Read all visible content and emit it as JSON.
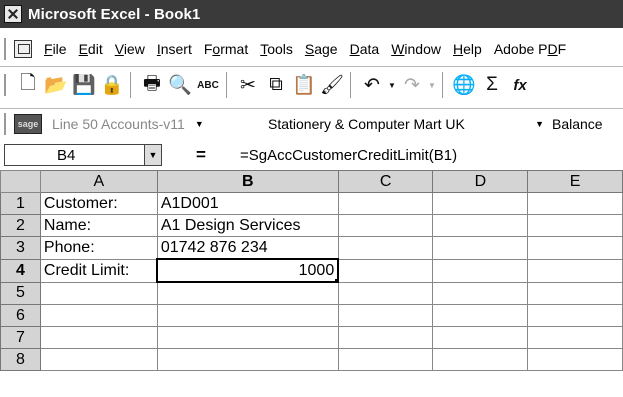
{
  "window": {
    "title": "Microsoft Excel - Book1"
  },
  "menu": [
    {
      "name": "file",
      "pre": "",
      "ul": "F",
      "post": "ile"
    },
    {
      "name": "edit",
      "pre": "",
      "ul": "E",
      "post": "dit"
    },
    {
      "name": "view",
      "pre": "",
      "ul": "V",
      "post": "iew"
    },
    {
      "name": "insert",
      "pre": "",
      "ul": "I",
      "post": "nsert"
    },
    {
      "name": "format",
      "pre": "F",
      "ul": "o",
      "post": "rmat"
    },
    {
      "name": "tools",
      "pre": "",
      "ul": "T",
      "post": "ools"
    },
    {
      "name": "sage",
      "pre": "",
      "ul": "S",
      "post": "age"
    },
    {
      "name": "data",
      "pre": "",
      "ul": "D",
      "post": "ata"
    },
    {
      "name": "window",
      "pre": "",
      "ul": "W",
      "post": "indow"
    },
    {
      "name": "help",
      "pre": "",
      "ul": "H",
      "post": "elp"
    },
    {
      "name": "adobe-pdf",
      "pre": "Adobe P",
      "ul": "D",
      "post": "F"
    }
  ],
  "toolbar": {
    "new": "🗋",
    "open": "📂",
    "save": "💾",
    "permission": "🔒",
    "print": "🖶",
    "preview": "🔍",
    "spelling": "ABC",
    "cut": "✂",
    "copy": "⧉",
    "paste": "📋",
    "format_painter": "🖌",
    "undo": "↶",
    "redo": "↷",
    "hyperlink": "🌐",
    "autosum": "Σ",
    "function": "fx"
  },
  "sage": {
    "logo": "sage",
    "company": "Line 50 Accounts-v11",
    "account": "Stationery & Computer Mart UK",
    "report": "Balance"
  },
  "formula": {
    "cell_ref": "B4",
    "equals": "=",
    "expression": "=SgAccCustomerCreditLimit(B1)"
  },
  "sheet": {
    "columns": [
      "A",
      "B",
      "C",
      "D",
      "E"
    ],
    "rows": [
      {
        "num": "1",
        "a": "Customer:",
        "b": "A1D001"
      },
      {
        "num": "2",
        "a": "Name:",
        "b": "A1 Design Services"
      },
      {
        "num": "3",
        "a": "Phone:",
        "b": "01742 876 234"
      },
      {
        "num": "4",
        "a": "Credit Limit:",
        "b": "1000"
      },
      {
        "num": "5",
        "a": "",
        "b": ""
      },
      {
        "num": "6",
        "a": "",
        "b": ""
      },
      {
        "num": "7",
        "a": "",
        "b": ""
      },
      {
        "num": "8",
        "a": "",
        "b": ""
      }
    ]
  }
}
